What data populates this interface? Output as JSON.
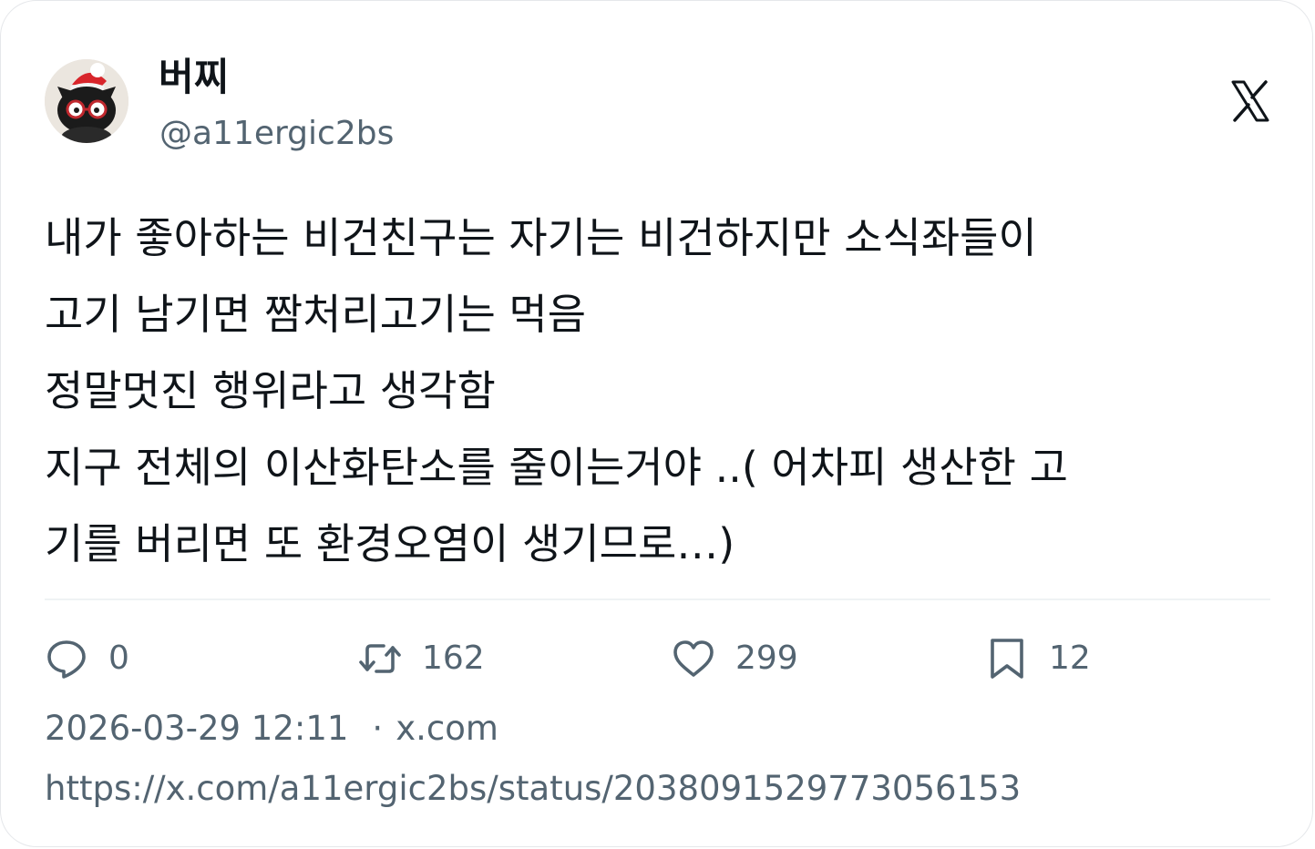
{
  "author": {
    "display_name": "버찌",
    "handle": "@a11ergic2bs",
    "avatar_icon": "black-cat-avatar-icon"
  },
  "brand_icon": "x-logo-icon",
  "tweet": {
    "lines": [
      "내가 좋아하는 비건친구는 자기는 비건하지만 소식좌들이",
      "고기 남기면 짬처리고기는 먹음",
      "정말멋진 행위라고 생각함",
      "지구 전체의 이산화탄소를 줄이는거야 ..( 어차피 생산한 고",
      "기를 버리면 또 환경오염이 생기므로…)"
    ]
  },
  "actions": {
    "reply": {
      "icon": "reply-icon",
      "count": "0"
    },
    "repost": {
      "icon": "repost-icon",
      "count": "162"
    },
    "like": {
      "icon": "heart-icon",
      "count": "299"
    },
    "bookmark": {
      "icon": "bookmark-icon",
      "count": "12"
    }
  },
  "meta": {
    "timestamp": "2026-03-29 12:11",
    "separator": "·",
    "source": "x.com"
  },
  "url": "https://x.com/a11ergic2bs/status/2038091529773056153",
  "colors": {
    "text_primary": "#0f1419",
    "text_secondary": "#536471",
    "border": "#e5e7ea"
  }
}
